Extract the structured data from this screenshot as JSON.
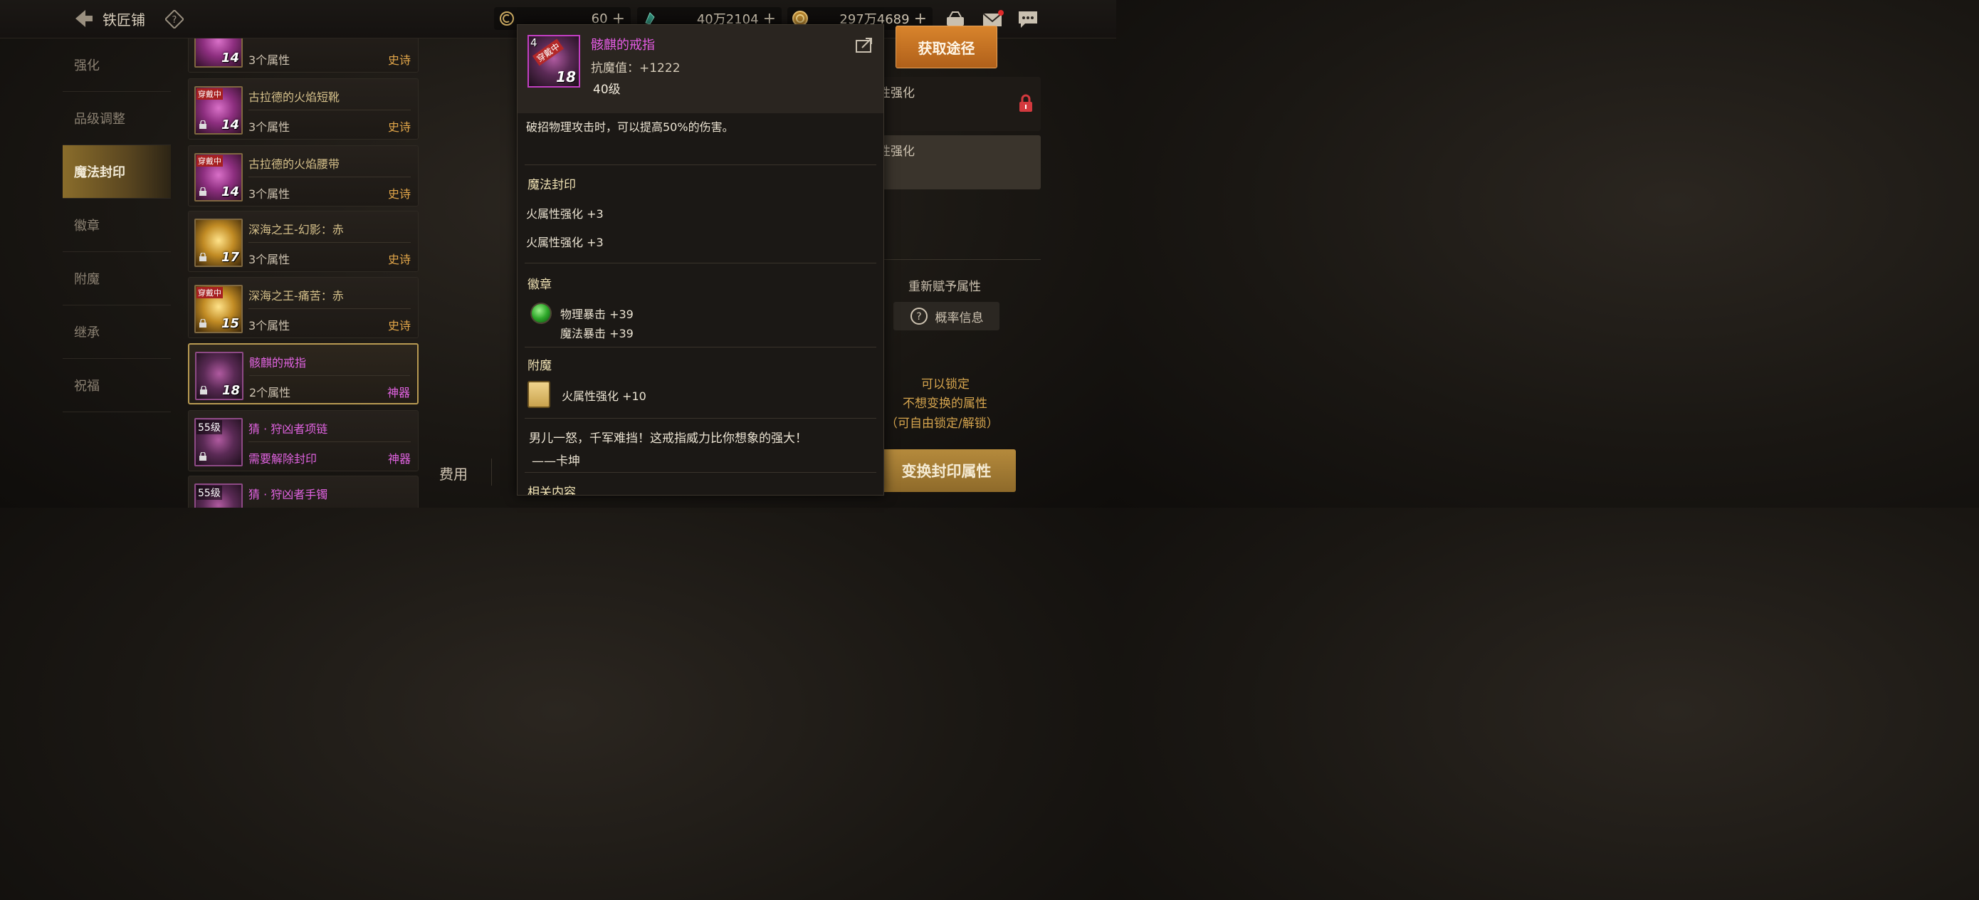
{
  "header": {
    "title": "铁匠铺",
    "resources": [
      {
        "icon": "fatigue-icon",
        "value": "60"
      },
      {
        "icon": "crystal-icon",
        "value": "40万2104"
      },
      {
        "icon": "gold-coin-icon",
        "value": "297万4689"
      }
    ]
  },
  "menu": {
    "items": [
      "强化",
      "品级调整",
      "魔法封印",
      "徽章",
      "附魔",
      "继承",
      "祝福"
    ],
    "active": "魔法封印"
  },
  "list": {
    "items": [
      {
        "name": "",
        "attr": "3个属性",
        "rarity": "史诗",
        "level": "14",
        "badge": ""
      },
      {
        "name": "古拉德的火焰短靴",
        "attr": "3个属性",
        "rarity": "史诗",
        "level": "14",
        "badge": "穿戴中"
      },
      {
        "name": "古拉德的火焰腰带",
        "attr": "3个属性",
        "rarity": "史诗",
        "level": "14",
        "badge": "穿戴中"
      },
      {
        "name": "深海之王-幻影：赤",
        "attr": "3个属性",
        "rarity": "史诗",
        "level": "17",
        "badge": ""
      },
      {
        "name": "深海之王-痛苦：赤",
        "attr": "3个属性",
        "rarity": "史诗",
        "level": "15",
        "badge": "穿戴中"
      },
      {
        "name": "骸麒的戒指",
        "attr": "2个属性",
        "rarity": "神器",
        "level": "18",
        "badge": ""
      },
      {
        "name": "猜 · 狩凶者项链",
        "attr": "需要解除封印",
        "rarity": "神器",
        "level": "",
        "badge": "55级"
      },
      {
        "name": "猜 · 狩凶者手镯",
        "attr": "",
        "rarity": "",
        "level": "",
        "badge": "55级"
      }
    ]
  },
  "right_panel": {
    "get_button": "获取途径",
    "row1": "火属性强化",
    "row2": "火属性强化",
    "reassign": "重新赋予属性",
    "probability": "概率信息",
    "lock_hint_1": "可以锁定",
    "lock_hint_2": "不想变换的属性",
    "lock_hint_3": "（可自由锁定/解锁）",
    "swap_button": "变换封印属性",
    "fee_label": "费用"
  },
  "tooltip": {
    "name": "骸麒的戒指",
    "stat": "抗魔值：+1222",
    "level_text": "40级",
    "thumb_num": "4",
    "thumb_level": "18",
    "thumb_stamp": "穿戴中",
    "description": "破招物理攻击时，可以提高50%的伤害。",
    "seal_title": "魔法封印",
    "seal_lines": [
      "火属性强化 +3",
      "火属性强化 +3"
    ],
    "emblem_title": "徽章",
    "emblem_lines": [
      "物理暴击 +39",
      "魔法暴击 +39"
    ],
    "enchant_title": "附魔",
    "enchant_line": "火属性强化 +10",
    "flavor": "男儿一怒，千军难挡！这戒指威力比你想象的强大！",
    "flavor_author": "——卡坤",
    "related": "相关内容"
  },
  "colors": {
    "accent_orange": "#d8842c",
    "artifact_pink": "#e063e0",
    "epic_orange": "#e3a74a",
    "menu_active": "#8a6d2b"
  }
}
